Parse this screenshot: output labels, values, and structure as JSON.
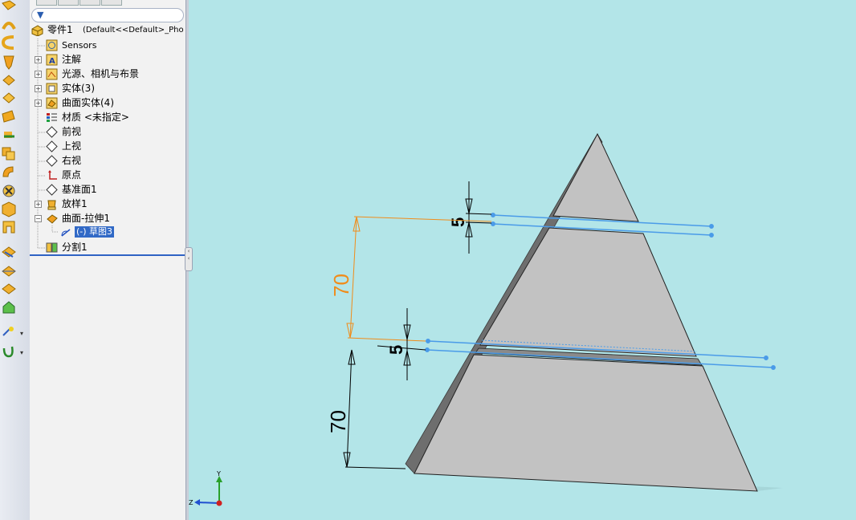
{
  "tree": {
    "root_label": "零件1",
    "root_config": "(Default<<Default>_Pho",
    "items": [
      {
        "label": "Sensors"
      },
      {
        "label": "注解"
      },
      {
        "label": "光源、相机与布景"
      },
      {
        "label": "实体(3)"
      },
      {
        "label": "曲面实体(4)"
      },
      {
        "label": "材质 <未指定>"
      },
      {
        "label": "前视"
      },
      {
        "label": "上视"
      },
      {
        "label": "右视"
      },
      {
        "label": "原点"
      },
      {
        "label": "基准面1"
      },
      {
        "label": "放样1"
      },
      {
        "label": "曲面-拉伸1"
      },
      {
        "label": "(-) 草图3"
      },
      {
        "label": "分割1"
      }
    ]
  },
  "dimensions": {
    "top_gap": "5",
    "mid_gap": "5",
    "upper_height": "70",
    "lower_height": "70"
  },
  "triad": {
    "y": "Y",
    "z": "Z"
  },
  "colors": {
    "viewport_bg": "#b3e5e8",
    "solid_face": "#c0c0c0",
    "solid_side": "#6b6b6b",
    "sketch_line": "#4a9be8",
    "selected_dim": "#f08c1a",
    "dim": "#000000"
  },
  "toolbar_icons": [
    "extruded-boss-icon",
    "revolved-boss-icon",
    "swept-boss-icon",
    "lofted-boss-icon",
    "boundary-boss-icon",
    "extruded-cut-icon",
    "hole-icon",
    "revolved-cut-icon",
    "swept-cut-icon",
    "lofted-cut-icon",
    "fillet-icon",
    "pattern-icon",
    "rib-icon",
    "draft-icon",
    "shell-icon",
    "wrap-icon",
    "intersect-icon",
    "dome-icon",
    "reference-geometry-icon",
    "curves-icon"
  ]
}
